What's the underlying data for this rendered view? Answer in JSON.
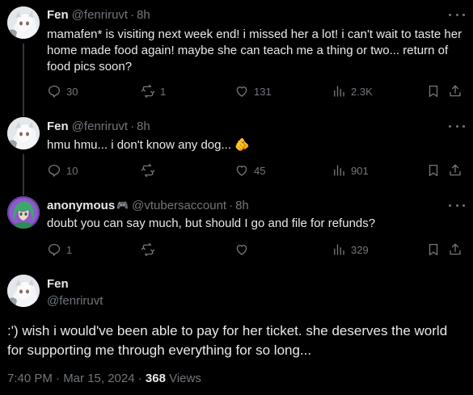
{
  "tweets": [
    {
      "name": "Fen",
      "handle": "@fenriruvt",
      "separator": "·",
      "time": "8h",
      "text": "mamafen* is visiting next week end! i missed her a lot! i can't wait to taste her home made food again! maybe she can teach me a thing or two... return of food pics soon?",
      "replies": "30",
      "retweets": "1",
      "likes": "131",
      "views": "2.3K",
      "avatar": "fen-avatar"
    },
    {
      "name": "Fen",
      "handle": "@fenriruvt",
      "separator": "·",
      "time": "8h",
      "text": "hmu hmu... i don't know any dog... 🫵",
      "replies": "10",
      "retweets": "",
      "likes": "45",
      "views": "901",
      "avatar": "fen-avatar"
    },
    {
      "name": "anonymous",
      "badge": "🎮",
      "handle": "@vtubersaccount",
      "separator": "·",
      "time": "8h",
      "text": "doubt you can say much, but should I go and file for refunds?",
      "replies": "1",
      "retweets": "",
      "likes": "",
      "views": "329",
      "avatar": "anonymous-avatar"
    }
  ],
  "main_tweet": {
    "name": "Fen",
    "handle": "@fenriruvt",
    "text": ":') wish i would've been able to pay for her ticket. she deserves the world for supporting me through everything for so long...",
    "timestamp": "7:40 PM · Mar 15, 2024 · ",
    "views_count": "368",
    "views_label": " Views",
    "avatar": "fen-avatar"
  },
  "colors": {
    "background": "#000000",
    "text": "#e7e9ea",
    "muted": "#71767b",
    "divider": "#333639"
  }
}
